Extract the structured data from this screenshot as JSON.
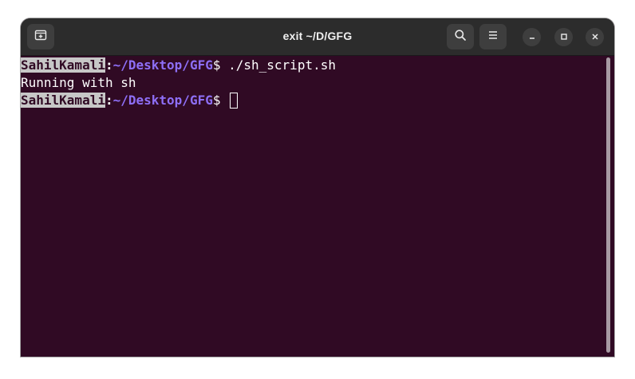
{
  "window": {
    "title": "exit ~/D/GFG"
  },
  "icons": {
    "new_tab": "new-tab-icon",
    "search": "search-icon",
    "menu": "hamburger-menu-icon",
    "minimize": "minimize-icon",
    "maximize": "maximize-icon",
    "close": "close-icon"
  },
  "terminal": {
    "lines": [
      {
        "user": "SahilKamali",
        "colon": ":",
        "path": "~/Desktop/GFG",
        "dollar": "$",
        "command": " ./sh_script.sh"
      },
      {
        "output": "Running with sh"
      },
      {
        "user": "SahilKamali",
        "colon": ":",
        "path": "~/Desktop/GFG",
        "dollar": "$",
        "command": " "
      }
    ]
  },
  "colors": {
    "terminal_bg": "#300a24",
    "titlebar_bg": "#2c2c2c",
    "path": "#8e6ff7",
    "user_highlight": "#c7c7c7"
  }
}
